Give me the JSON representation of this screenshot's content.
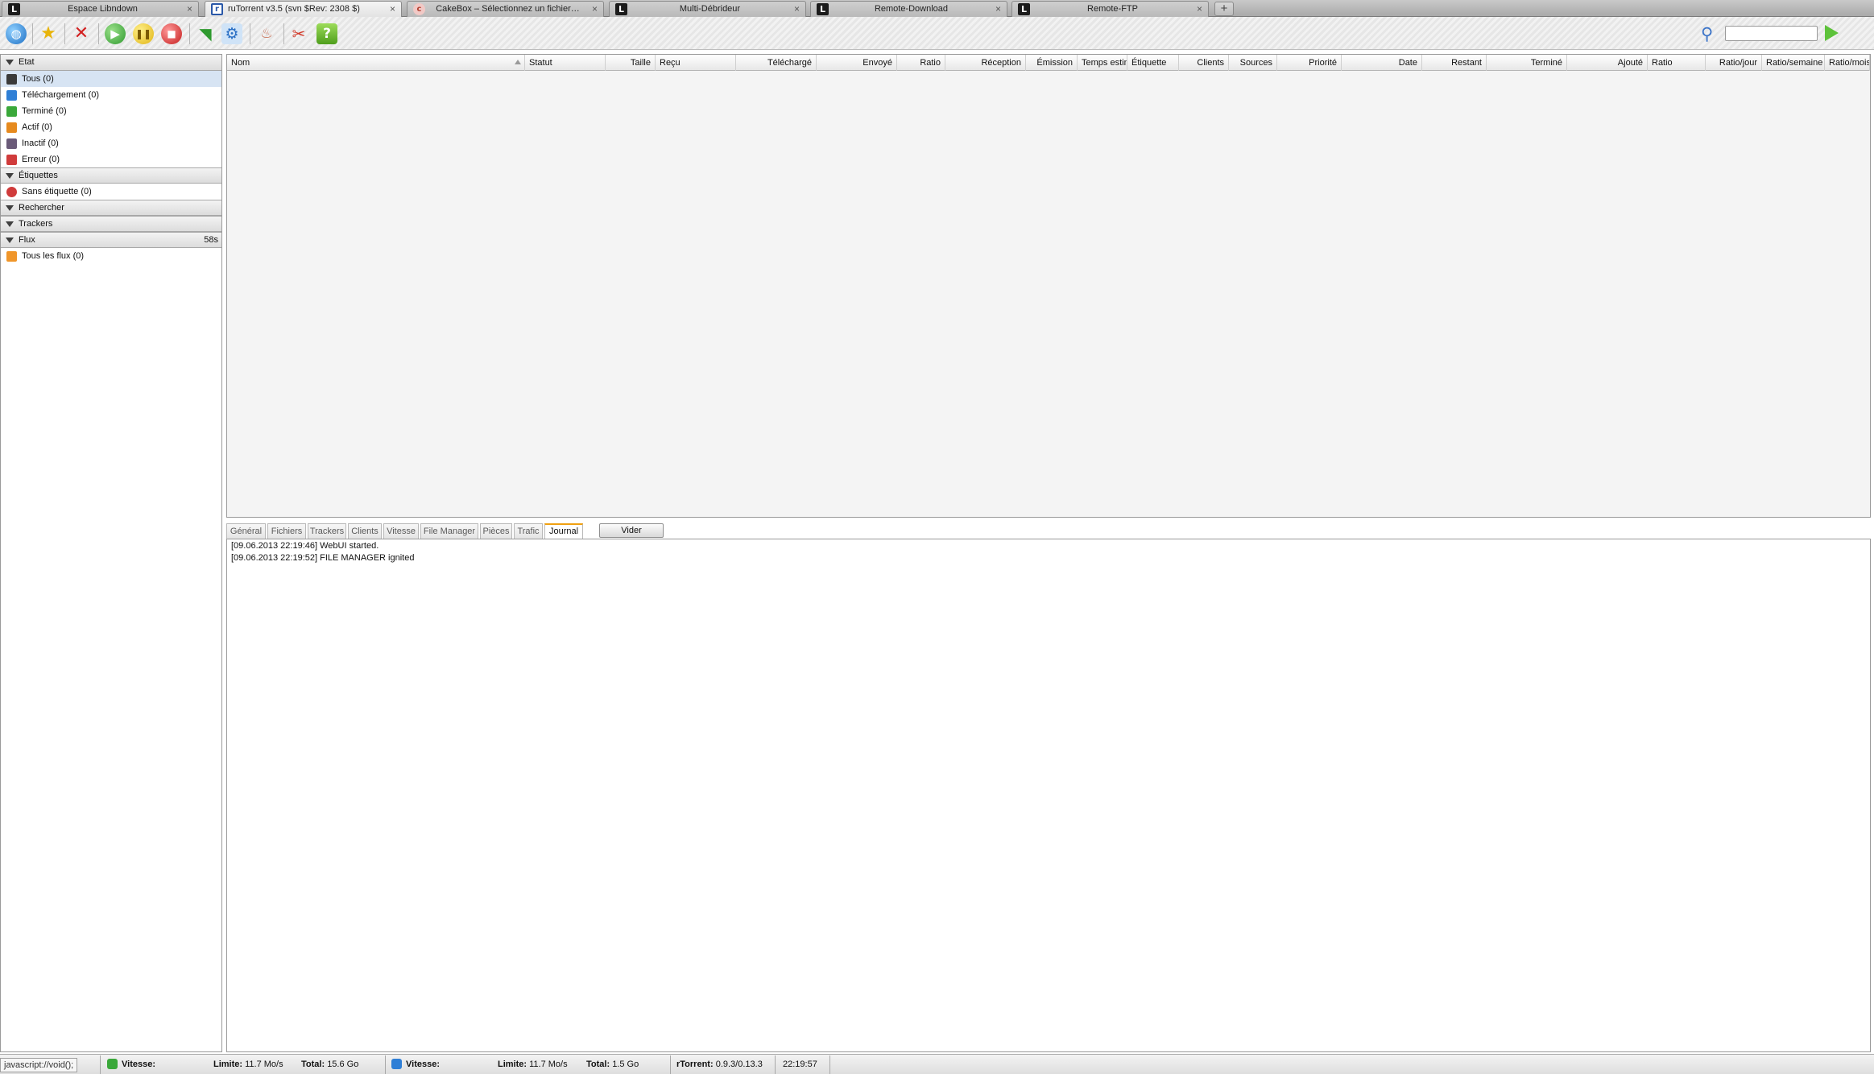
{
  "browser": {
    "tabs": [
      {
        "title": "Espace Libndown",
        "favicon": "L"
      },
      {
        "title": "ruTorrent v3.5 (svn $Rev: 2308 $)",
        "favicon": "r",
        "active": true
      },
      {
        "title": "CakeBox – Sélectionnez un fichier…",
        "favicon": "c"
      },
      {
        "title": "Multi-Débrideur",
        "favicon": "L"
      },
      {
        "title": "Remote-Download",
        "favicon": "L"
      },
      {
        "title": "Remote-FTP",
        "favicon": "L"
      }
    ],
    "close_glyph": "×",
    "new_tab_glyph": "+"
  },
  "toolbar": {
    "icons": [
      "globe-icon",
      "star-icon",
      "remove-icon",
      "start-icon",
      "pause-icon",
      "stop-icon",
      "rss-icon",
      "settings-icon",
      "cake-icon",
      "tools-icon",
      "help-icon"
    ],
    "search_value": ""
  },
  "sidebar": {
    "sections": {
      "etat": {
        "label": "Etat",
        "items": [
          {
            "label": "Tous (0)",
            "color": "#3a3a3a"
          },
          {
            "label": "Téléchargement (0)",
            "color": "#2f7fd6"
          },
          {
            "label": "Terminé (0)",
            "color": "#3aa83a"
          },
          {
            "label": "Actif (0)",
            "color": "#e68a1e"
          },
          {
            "label": "Inactif (0)",
            "color": "#6a5a78"
          },
          {
            "label": "Erreur (0)",
            "color": "#d03b3b"
          }
        ]
      },
      "etiquettes": {
        "label": "Étiquettes",
        "items": [
          {
            "label": "Sans étiquette (0)",
            "color": "#d03b3b"
          }
        ]
      },
      "rechercher": {
        "label": "Rechercher"
      },
      "trackers": {
        "label": "Trackers"
      },
      "flux": {
        "label": "Flux",
        "timer": "58s",
        "items": [
          {
            "label": "Tous les flux (0)",
            "color": "#f0962a"
          }
        ]
      }
    }
  },
  "torrent_list": {
    "columns": [
      "Nom",
      "Statut",
      "Taille",
      "Reçu",
      "Téléchargé",
      "Envoyé",
      "Ratio",
      "Réception",
      "Émission",
      "Temps estimé",
      "Étiquette",
      "Clients",
      "Sources",
      "Priorité",
      "Date",
      "Restant",
      "Terminé",
      "Ajouté",
      "Ratio",
      "Ratio/jour",
      "Ratio/semaine",
      "Ratio/mois"
    ]
  },
  "details": {
    "tabs": [
      "Général",
      "Fichiers",
      "Trackers",
      "Clients",
      "Vitesse",
      "File Manager",
      "Pièces",
      "Trafic",
      "Journal"
    ],
    "active_tab": "Journal",
    "clear_label": "Vider",
    "log": [
      "[09.06.2013 22:19:46] WebUI started.",
      "[09.06.2013 22:19:52] FILE MANAGER ignited"
    ]
  },
  "statusbar": {
    "js_url": "javascript://void();",
    "download": {
      "speed_label": "Vitesse:",
      "limit_label": "Limite:",
      "limit_value": "11.7 Mo/s",
      "total_label": "Total:",
      "total_value": "15.6 Go"
    },
    "upload": {
      "speed_label": "Vitesse:",
      "limit_label": "Limite:",
      "limit_value": "11.7 Mo/s",
      "total_label": "Total:",
      "total_value": "1.5 Go"
    },
    "rtorrent_label": "rTorrent:",
    "rtorrent_version": "0.9.3/0.13.3",
    "time": "22:19:57"
  }
}
